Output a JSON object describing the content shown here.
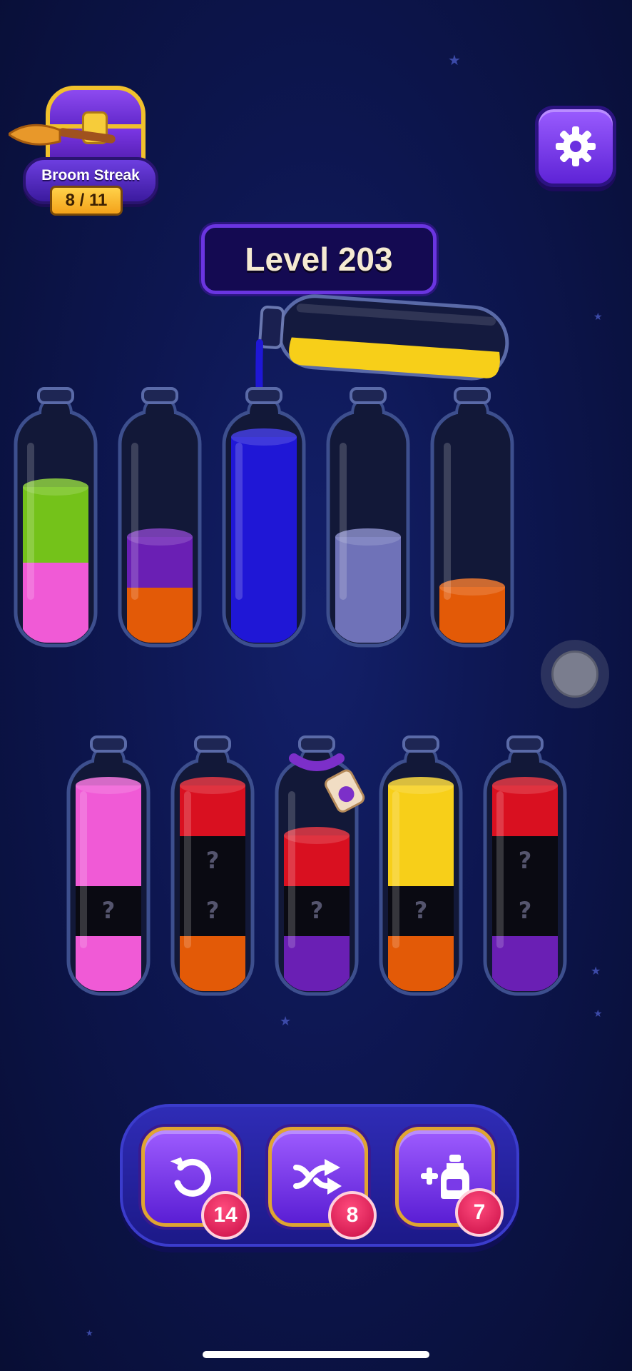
{
  "streak": {
    "label": "Broom Streak",
    "count": "8 / 11"
  },
  "settings": {
    "icon": "gear-icon"
  },
  "level": {
    "label": "Level 203"
  },
  "colors": {
    "green": "#74c21a",
    "pink": "#f05ad6",
    "purple": "#6a1fb4",
    "orange": "#e35a07",
    "blue": "#1f17d6",
    "lavender": "#6f72b8",
    "yellow": "#f7cf19",
    "red": "#d91020",
    "hidden": "#0a0a12"
  },
  "pouring_bottle": {
    "contents": [
      "yellow"
    ],
    "fill_fraction": 0.4,
    "pouring_into": 2,
    "pour_color": "blue"
  },
  "top_row": [
    {
      "layers": [
        "pink",
        "green"
      ],
      "fill_fraction": 0.75
    },
    {
      "layers": [
        "orange",
        "purple"
      ],
      "fill_fraction": 0.5
    },
    {
      "layers": [
        "blue"
      ],
      "fill_fraction": 1.0
    },
    {
      "layers": [
        "lavender"
      ],
      "fill_fraction": 0.5
    },
    {
      "layers": [
        "orange"
      ],
      "fill_fraction": 0.25
    }
  ],
  "bottom_row": [
    {
      "layers": [
        "pink",
        "hidden",
        "pink",
        "pink"
      ],
      "fill_fraction": 1.0,
      "hidden_mark": "?"
    },
    {
      "layers": [
        "orange",
        "hidden",
        "hidden",
        "red"
      ],
      "fill_fraction": 1.0,
      "hidden_mark": "?"
    },
    {
      "layers": [
        "purple",
        "hidden",
        "red"
      ],
      "fill_fraction": 0.75,
      "hidden_mark": "?",
      "locked": true
    },
    {
      "layers": [
        "orange",
        "hidden",
        "yellow",
        "yellow"
      ],
      "fill_fraction": 1.0,
      "hidden_mark": "?"
    },
    {
      "layers": [
        "purple",
        "hidden",
        "hidden",
        "red"
      ],
      "fill_fraction": 1.0,
      "hidden_mark": "?"
    }
  ],
  "powerups": [
    {
      "name": "undo",
      "icon": "undo-icon",
      "count": "14"
    },
    {
      "name": "shuffle",
      "icon": "shuffle-icon",
      "count": "8"
    },
    {
      "name": "add-bottle",
      "icon": "add-bottle-icon",
      "count": "7"
    }
  ]
}
